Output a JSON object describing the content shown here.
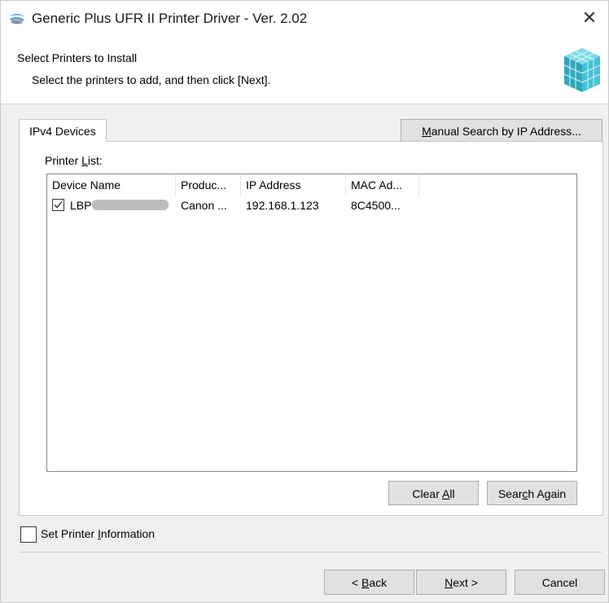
{
  "window": {
    "title": "Generic Plus UFR II Printer Driver - Ver. 2.02",
    "close_glyph": "✕"
  },
  "header": {
    "title": "Select Printers to Install",
    "subtitle": "Select the printers to add, and then click [Next]."
  },
  "tabs": [
    {
      "label": "IPv4 Devices",
      "selected": true
    }
  ],
  "manual_search": {
    "pre": "",
    "accel": "M",
    "post": "anual Search by IP Address..."
  },
  "printer_list": {
    "label_pre": "Printer ",
    "label_accel": "L",
    "label_post": "ist:",
    "columns": [
      "Device Name",
      "Produc...",
      "IP Address",
      "MAC Ad..."
    ],
    "rows": [
      {
        "checked": true,
        "device_name": "LBP",
        "product": "Canon ...",
        "ip_address": "192.168.1.123",
        "mac_address": "8C4500..."
      }
    ]
  },
  "buttons": {
    "clear_all": {
      "pre": "Clear ",
      "accel": "A",
      "post": "ll"
    },
    "search_again": {
      "pre": "Sear",
      "accel": "c",
      "post": "h Again"
    },
    "back": {
      "pre": "< ",
      "accel": "B",
      "post": "ack"
    },
    "next": {
      "pre": "",
      "accel": "N",
      "post": "ext >"
    },
    "cancel": {
      "label": "Cancel"
    }
  },
  "set_printer_info": {
    "checked": false,
    "pre": "Set Printer ",
    "accel": "I",
    "post": "nformation"
  },
  "icons": {
    "app": "printer-driver-icon",
    "logo": "printer-cube-logo-icon",
    "checkbox": "checkmark-icon"
  },
  "colors": {
    "button_face": "#e1e1e1",
    "button_border": "#adadad",
    "logo_teal": "#3fb8c8"
  }
}
